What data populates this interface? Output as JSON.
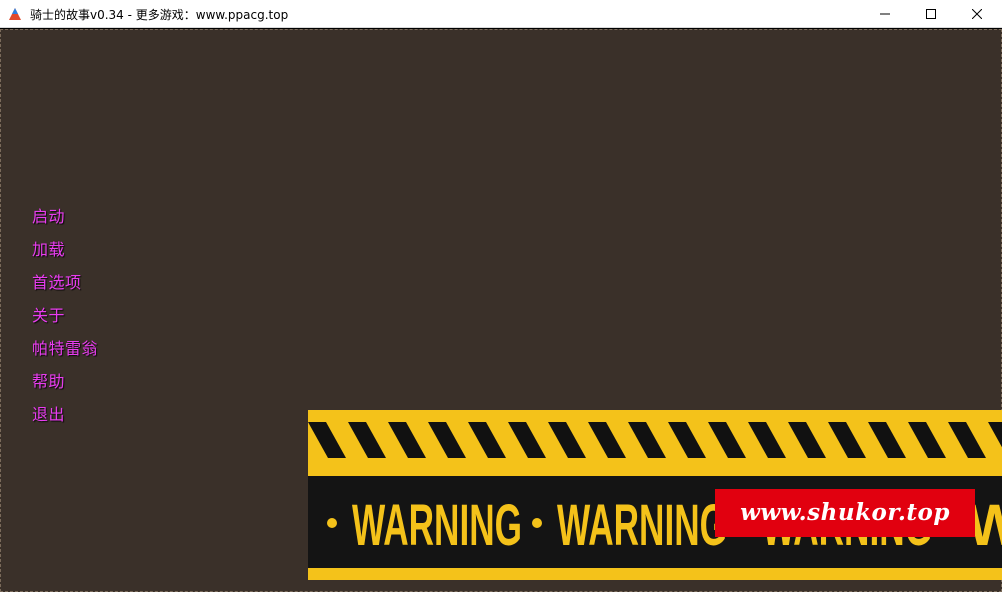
{
  "window": {
    "title": "骑士的故事v0.34 - 更多游戏：www.ppacg.top",
    "icon": "renpy-triangle-icon"
  },
  "controls": {
    "minimize_icon": "minimize-icon",
    "maximize_icon": "maximize-icon",
    "close_icon": "close-icon"
  },
  "menu": {
    "items": [
      {
        "label": "启动"
      },
      {
        "label": "加载"
      },
      {
        "label": "首选项"
      },
      {
        "label": "关于"
      },
      {
        "label": "帕特雷翁"
      },
      {
        "label": "帮助"
      },
      {
        "label": "退出"
      }
    ],
    "color": "#e93df0"
  },
  "banner": {
    "tape_text": [
      "WARNING",
      "WARNING",
      "WARNING",
      "W"
    ],
    "tape_color": "#f4c21a",
    "watermark": "www.shukor.top",
    "watermark_color": "#e1000f"
  }
}
